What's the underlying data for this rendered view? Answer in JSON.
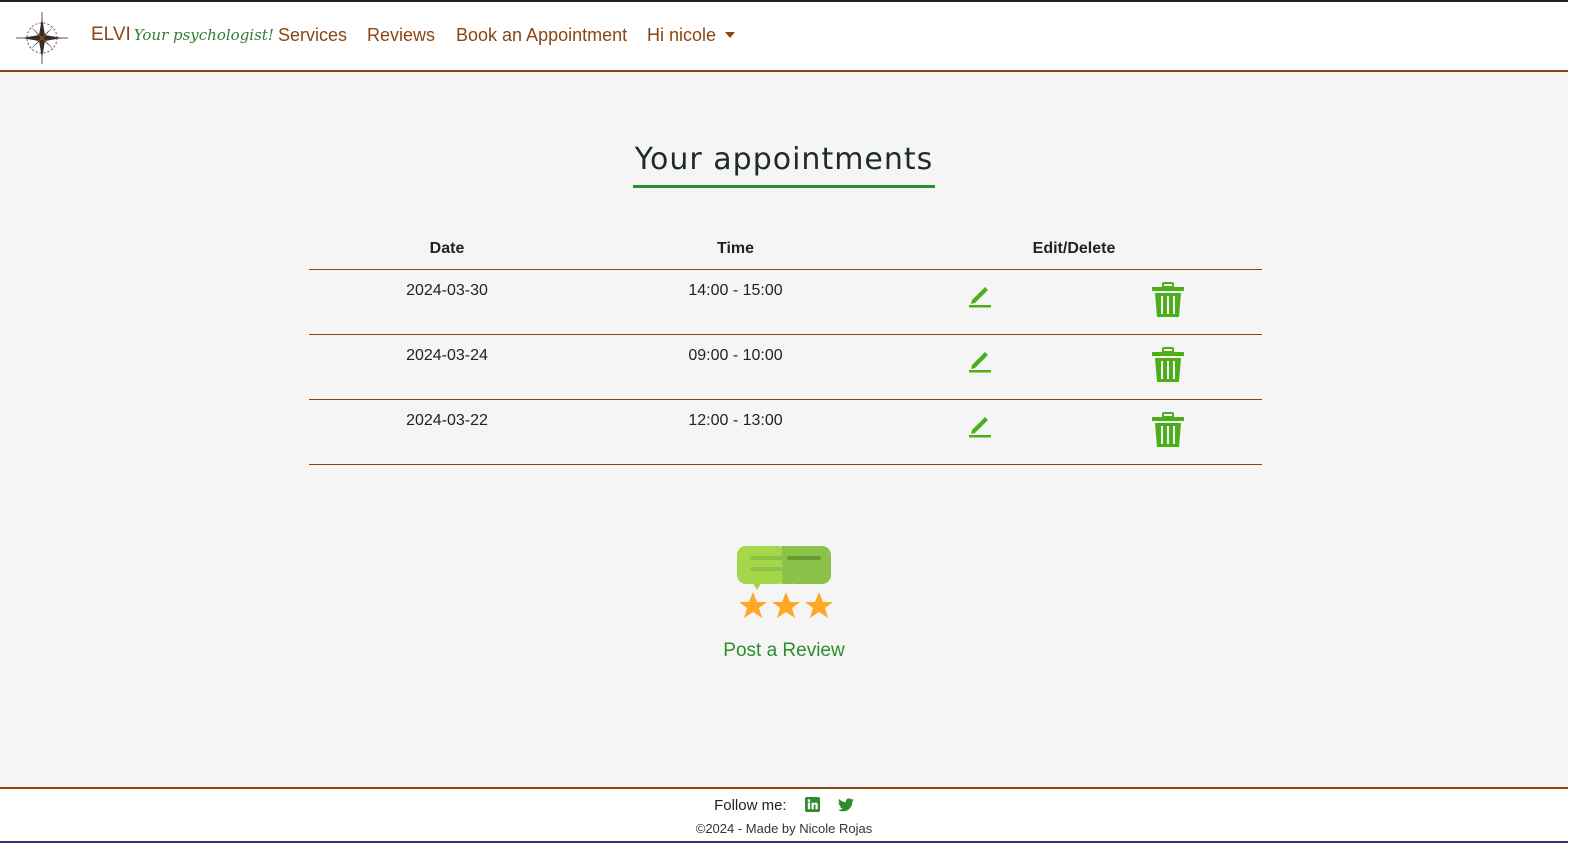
{
  "nav": {
    "brand_name": "ELVI",
    "brand_tagline": "Your psychologist!",
    "links": [
      "Services",
      "Reviews",
      "Book an Appointment"
    ],
    "user_menu": "Hi nicole"
  },
  "main": {
    "title": "Your appointments",
    "table": {
      "headers": {
        "date": "Date",
        "time": "Time",
        "actions": "Edit/Delete"
      },
      "rows": [
        {
          "date": "2024-03-30",
          "time": "14:00 - 15:00"
        },
        {
          "date": "2024-03-24",
          "time": "09:00 - 10:00"
        },
        {
          "date": "2024-03-22",
          "time": "12:00 - 13:00"
        }
      ]
    },
    "review_link": "Post a Review"
  },
  "footer": {
    "follow_label": "Follow me:",
    "copyright": "©2024 - Made by Nicole Rojas"
  },
  "colors": {
    "brand_brown": "#8b4513",
    "accent_green": "#2e8b2e",
    "icon_green": "#4caf1a"
  },
  "icons": [
    "compass-logo-icon",
    "pencil-icon",
    "trash-icon",
    "review-stars-icon",
    "linkedin-icon",
    "twitter-icon"
  ]
}
